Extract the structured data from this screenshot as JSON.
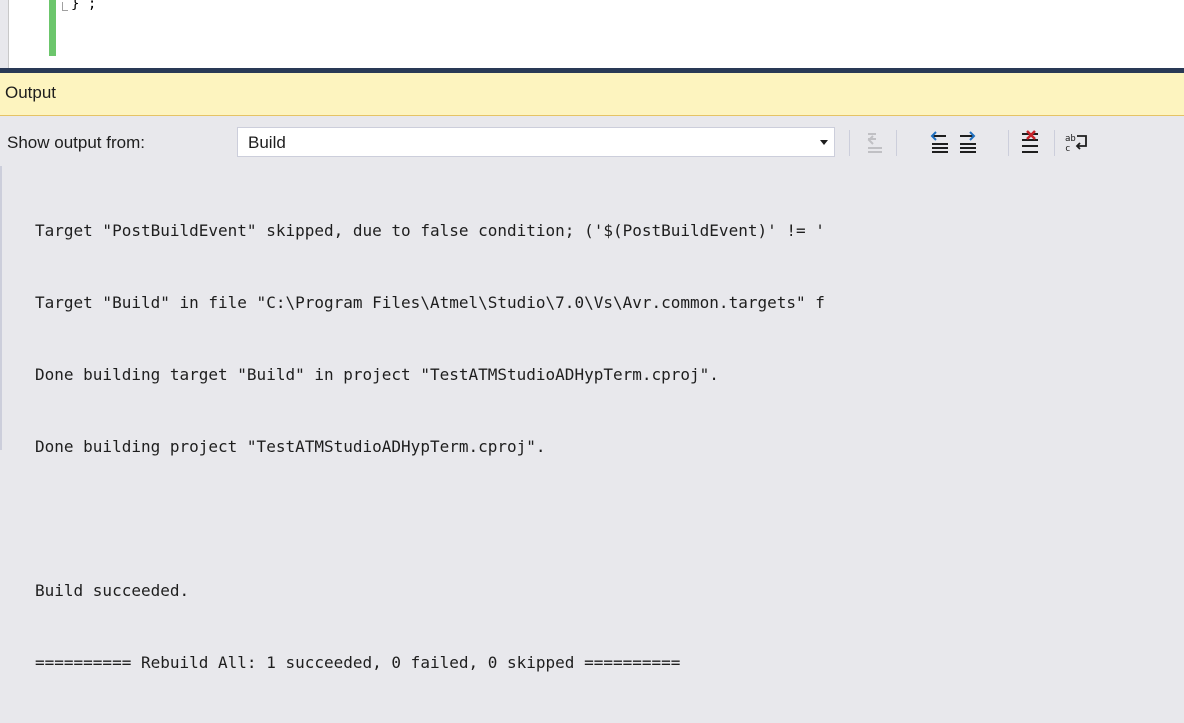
{
  "editor": {
    "code_fragment": "} ;",
    "change_bar_color": "#6cc66c"
  },
  "output_window": {
    "title": "Output",
    "show_output_label": "Show output from:",
    "source_selected": "Build",
    "toolbar_icons": [
      "goto-previous-message-icon",
      "find-previous-icon",
      "find-next-icon",
      "clear-all-icon",
      "toggle-word-wrap-icon"
    ],
    "log_lines": [
      "Target \"PostBuildEvent\" skipped, due to false condition; ('$(PostBuildEvent)' != '",
      "Target \"Build\" in file \"C:\\Program Files\\Atmel\\Studio\\7.0\\Vs\\Avr.common.targets\" f",
      "Done building target \"Build\" in project \"TestATMStudioADHypTerm.cproj\".",
      "Done building project \"TestATMStudioADHypTerm.cproj\".",
      "",
      "Build succeeded.",
      "========== Rebuild All: 1 succeeded, 0 failed, 0 skipped =========="
    ],
    "title_bar_color": "#fdf4bf"
  }
}
